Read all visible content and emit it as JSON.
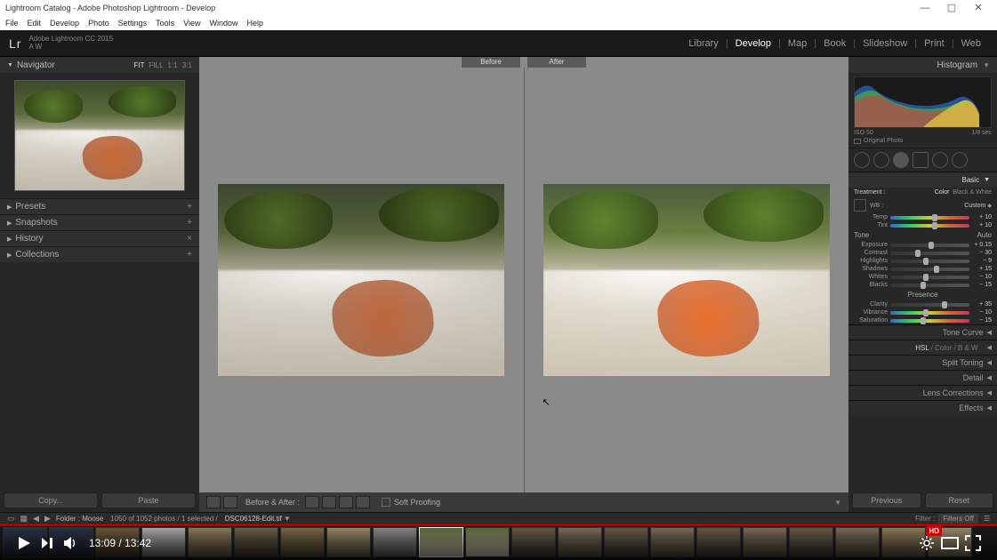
{
  "window": {
    "title": "Lightroom Catalog - Adobe Photoshop Lightroom - Develop",
    "min": "—",
    "max": "▢",
    "close": "✕",
    "menu": [
      "File",
      "Edit",
      "Develop",
      "Photo",
      "Settings",
      "Tools",
      "View",
      "Window",
      "Help"
    ]
  },
  "brand": {
    "logo": "Lr",
    "line1": "Adobe Lightroom CC 2015",
    "line2": "A W"
  },
  "modules": [
    "Library",
    "Develop",
    "Map",
    "Book",
    "Slideshow",
    "Print",
    "Web"
  ],
  "activeModule": "Develop",
  "navigator": {
    "title": "Navigator",
    "zoom": {
      "fit": "FIT",
      "fill": "FILL",
      "one": "1:1",
      "ratio": "3:1"
    }
  },
  "leftPanels": [
    {
      "name": "Presets",
      "action": "+"
    },
    {
      "name": "Snapshots",
      "action": "+"
    },
    {
      "name": "History",
      "action": "×"
    },
    {
      "name": "Collections",
      "action": "+"
    }
  ],
  "copyPaste": {
    "copy": "Copy...",
    "paste": "Paste"
  },
  "compare": {
    "before": "Before",
    "after": "After"
  },
  "toolbar": {
    "beforeAfter": "Before & After :",
    "softProof": "Soft Proofing"
  },
  "histogram": {
    "title": "Histogram",
    "iso": "ISO 50",
    "shutter": "1/8 sec",
    "original": "Original Photo"
  },
  "basic": {
    "title": "Basic",
    "treatment": {
      "label": "Treatment :",
      "color": "Color",
      "bw": "Black & White"
    },
    "wb": {
      "label": "WB :",
      "value": "Custom"
    },
    "tone": {
      "label": "Tone",
      "auto": "Auto"
    },
    "presence": "Presence",
    "sliders": {
      "temp": {
        "label": "Temp",
        "value": "+ 10",
        "pos": 56
      },
      "tint": {
        "label": "Tint",
        "value": "+ 10",
        "pos": 56
      },
      "exposure": {
        "label": "Exposure",
        "value": "+ 0.15",
        "pos": 52
      },
      "contrast": {
        "label": "Contrast",
        "value": "− 30",
        "pos": 35
      },
      "highlights": {
        "label": "Highlights",
        "value": "− 9",
        "pos": 45
      },
      "shadows": {
        "label": "Shadows",
        "value": "+ 15",
        "pos": 58
      },
      "whites": {
        "label": "Whites",
        "value": "− 10",
        "pos": 45
      },
      "blacks": {
        "label": "Blacks",
        "value": "− 15",
        "pos": 42
      },
      "clarity": {
        "label": "Clarity",
        "value": "+ 35",
        "pos": 68
      },
      "vibrance": {
        "label": "Vibrance",
        "value": "− 10",
        "pos": 45
      },
      "saturation": {
        "label": "Saturation",
        "value": "− 15",
        "pos": 42
      }
    }
  },
  "collapsed": {
    "tonecurve": "Tone Curve",
    "hsl": {
      "title": "",
      "hsl": "HSL",
      "color": "Color",
      "bw": "B & W"
    },
    "split": "Split Toning",
    "detail": "Detail",
    "lens": "Lens Corrections",
    "effects": "Effects"
  },
  "resetRow": {
    "previous": "Previous",
    "reset": "Reset"
  },
  "filmstripBar": {
    "folder": "Folder : Moose",
    "count": "1050 of 1052 photos / 1 selected /",
    "file": "DSC06128-Edit.tif",
    "filter": "Filter :",
    "filterVal": "Filters Off"
  },
  "video": {
    "time": "13:09 / 13:42",
    "hd": "HD"
  }
}
